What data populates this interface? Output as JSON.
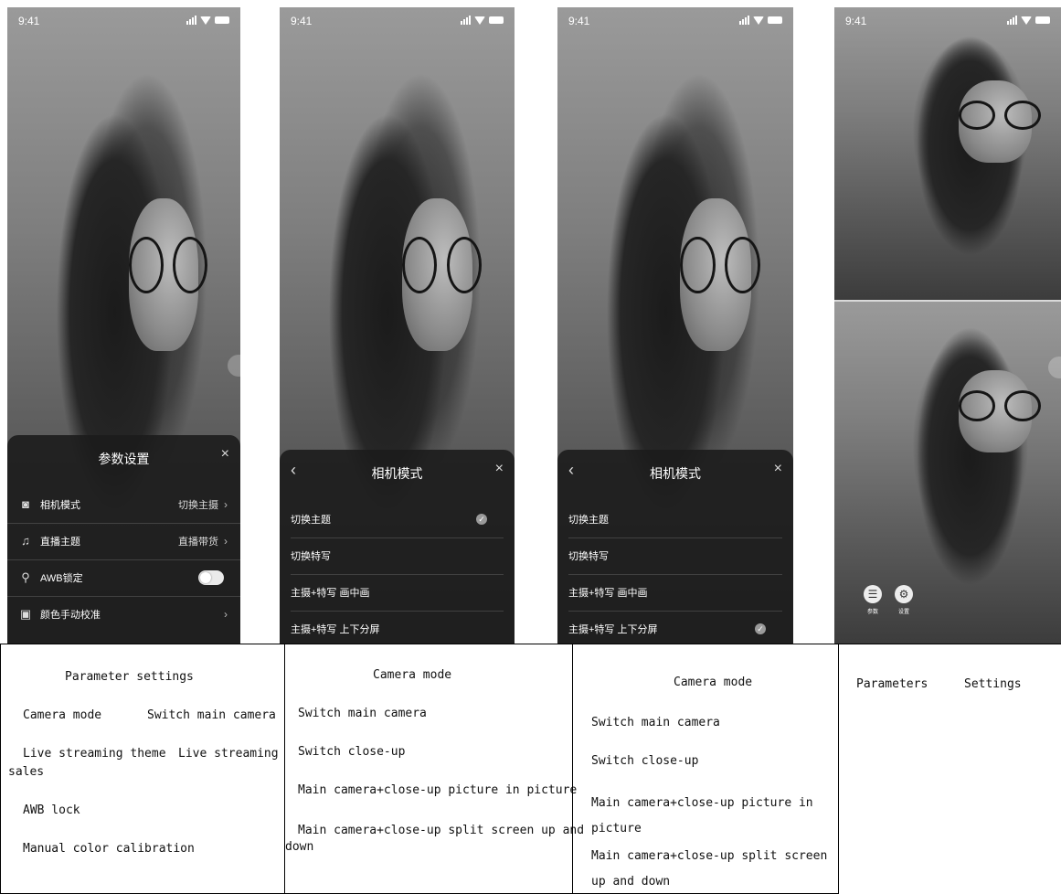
{
  "status": {
    "time": "9:41"
  },
  "screen1": {
    "sheet_title": "参数设置",
    "close_icon": "×",
    "rows": [
      {
        "label": "相机模式",
        "value": "切换主摄",
        "icon": "camera-icon"
      },
      {
        "label": "直播主题",
        "value": "直播带货",
        "icon": "bell-icon"
      },
      {
        "label": "AWB锁定",
        "value": "",
        "icon": "awb-icon"
      },
      {
        "label": "颜色手动校准",
        "value": "",
        "icon": "color-palette-icon"
      }
    ]
  },
  "screen2": {
    "sheet_title": "相机模式",
    "options": [
      {
        "label": "切换主题",
        "selected": true
      },
      {
        "label": "切换特写",
        "selected": false
      },
      {
        "label": "主摄+特写 画中画",
        "selected": false
      },
      {
        "label": "主摄+特写 上下分屏",
        "selected": false
      }
    ]
  },
  "screen3": {
    "sheet_title": "相机模式",
    "options": [
      {
        "label": "切换主题",
        "selected": false
      },
      {
        "label": "切换特写",
        "selected": false
      },
      {
        "label": "主摄+特写 画中画",
        "selected": false
      },
      {
        "label": "主摄+特写 上下分屏",
        "selected": true
      }
    ]
  },
  "screen4": {
    "buttons": [
      {
        "label": "参数",
        "icon": "sliders-icon"
      },
      {
        "label": "设置",
        "icon": "gear-icon"
      }
    ]
  },
  "translations": {
    "t1": {
      "title": "Parameter settings",
      "camera_mode": "Camera mode",
      "switch_main": "Switch main camera",
      "live_theme": "Live streaming theme",
      "live_sales_a": "Live streaming",
      "live_sales_b": "sales",
      "awb": "AWB lock",
      "manual_color": "Manual color calibration"
    },
    "t2": {
      "title": "Camera mode",
      "o1": "Switch main camera",
      "o2": "Switch close-up",
      "o3": "Main camera+close-up picture in picture",
      "o4a": "Main camera+close-up split screen up and",
      "o4b": "down"
    },
    "t3": {
      "title": "Camera mode",
      "o1": "Switch main camera",
      "o2": "Switch close-up",
      "o3a": "Main camera+close-up picture in",
      "o3b": "picture",
      "o4a": "Main camera+close-up split screen",
      "o4b": "up and down"
    },
    "t4": {
      "a": "Parameters",
      "b": "Settings"
    }
  }
}
